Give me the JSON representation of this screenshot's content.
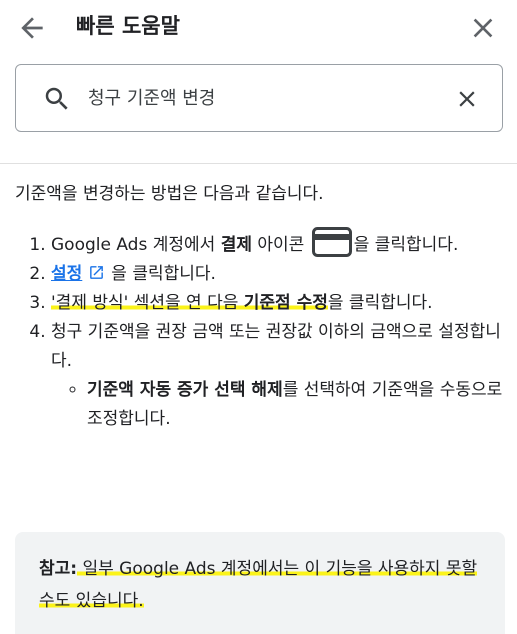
{
  "header": {
    "title": "빠른 도움말",
    "back_icon": "arrow-back-icon",
    "close_icon": "close-icon"
  },
  "search": {
    "value": "청구 기준액 변경",
    "search_icon": "search-icon",
    "clear_icon": "clear-icon"
  },
  "content": {
    "intro": "기준액을 변경하는 방법은 다음과 같습니다.",
    "steps": [
      {
        "pre": "Google Ads 계정에서 ",
        "bold": "결제",
        "mid": " 아이콘 ",
        "icon": "credit-card-icon",
        "post": "을 클릭합니다."
      },
      {
        "link": "설정",
        "link_icon": "open-in-new-icon",
        "post": "을 클릭합니다."
      },
      {
        "pre": "'결제 방식' 섹션을 연 다음 ",
        "bold": "기준점 수정",
        "post": "을 클릭합니다."
      },
      {
        "text": "청구 기준액을 권장 금액 또는 권장값 이하의 금액으로 설정합니다.",
        "sub": [
          {
            "bold": "기준액 자동 증가 선택 해제",
            "post": "를 선택하여 기준액을 수동으로 조정합니다."
          }
        ]
      }
    ]
  },
  "note": {
    "label": "참고:",
    "text": " 일부 Google Ads 계정에서는 이 기능을 사용하지 못할 수도 있습니다."
  },
  "colors": {
    "link": "#1a73e8",
    "highlight": "#fbf31a",
    "note_background": "#f1f3f4"
  }
}
